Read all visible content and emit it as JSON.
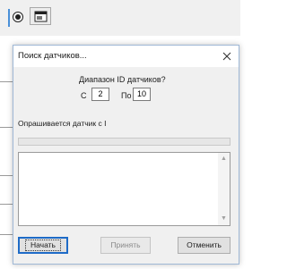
{
  "background_app": {
    "toolbar": {
      "radio_icon": "radio-selected-icon",
      "button_icon": "window-toolbar-icon"
    }
  },
  "dialog": {
    "title": "Поиск датчиков...",
    "close_icon": "close-icon",
    "range_label": "Диапазон ID датчиков?",
    "from_label": "С",
    "from_value": "2",
    "to_label": "По",
    "to_value": "10",
    "status_text": "Опрашивается датчик с I",
    "buttons": {
      "start": "Начать",
      "accept": "Принять",
      "cancel": "Отменить"
    },
    "colors": {
      "accent": "#1e6bc7",
      "disabled_text": "#8a8a8a"
    }
  }
}
